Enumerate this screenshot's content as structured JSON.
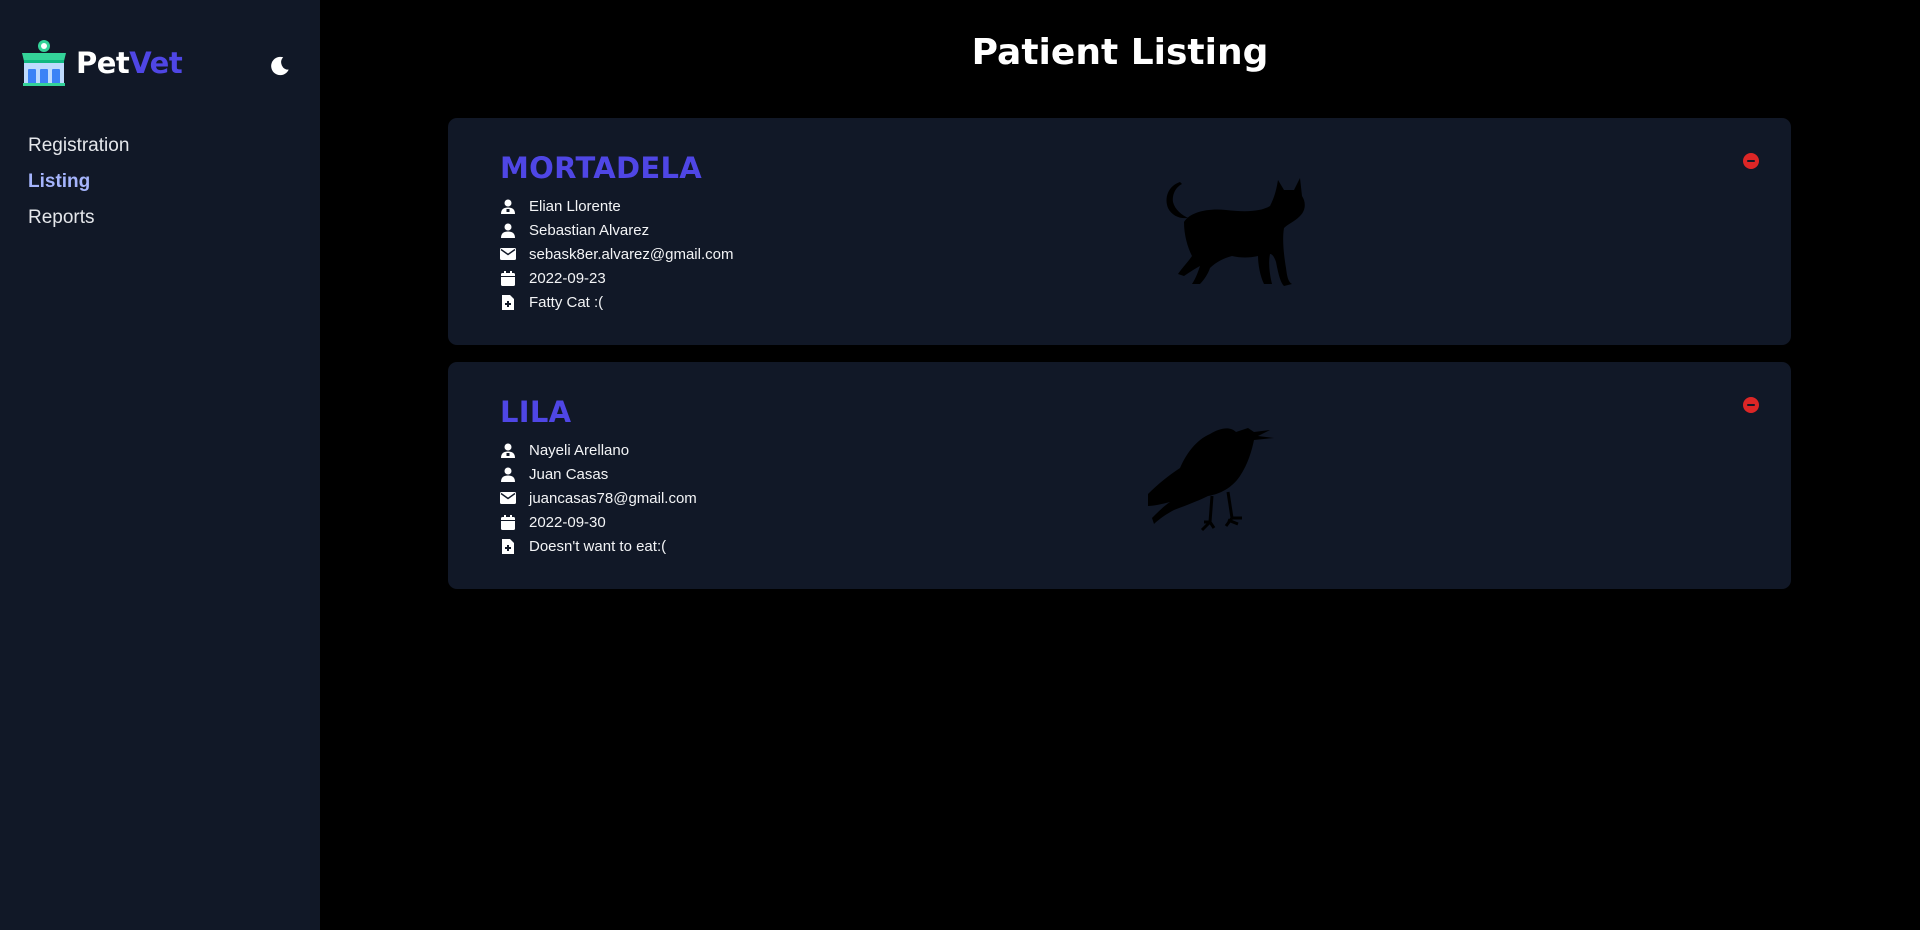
{
  "brand": {
    "part1": "Pet",
    "part2": "Vet",
    "accent": "#4f46e5"
  },
  "sidebar": {
    "theme_icon": "moon-icon",
    "items": [
      {
        "label": "Registration",
        "active": false
      },
      {
        "label": "Listing",
        "active": true
      },
      {
        "label": "Reports",
        "active": false
      }
    ]
  },
  "main": {
    "title": "Patient Listing",
    "patients": [
      {
        "name": "MORTADELA",
        "vet": "Elian Llorente",
        "owner": "Sebastian Alvarez",
        "email": "sebask8er.alvarez@gmail.com",
        "date": "2022-09-23",
        "symptoms": "Fatty Cat :(",
        "animal_icon": "cat-icon"
      },
      {
        "name": "LILA",
        "vet": "Nayeli Arellano",
        "owner": "Juan Casas",
        "email": "juancasas78@gmail.com",
        "date": "2022-09-30",
        "symptoms": "Doesn't want to eat:(",
        "animal_icon": "bird-icon"
      }
    ]
  },
  "colors": {
    "sidebar_bg": "#111827",
    "page_bg": "#000000",
    "card_bg": "#111827",
    "accent": "#4f46e5",
    "active_nav": "#a5b4fc",
    "remove": "#dc2626"
  }
}
